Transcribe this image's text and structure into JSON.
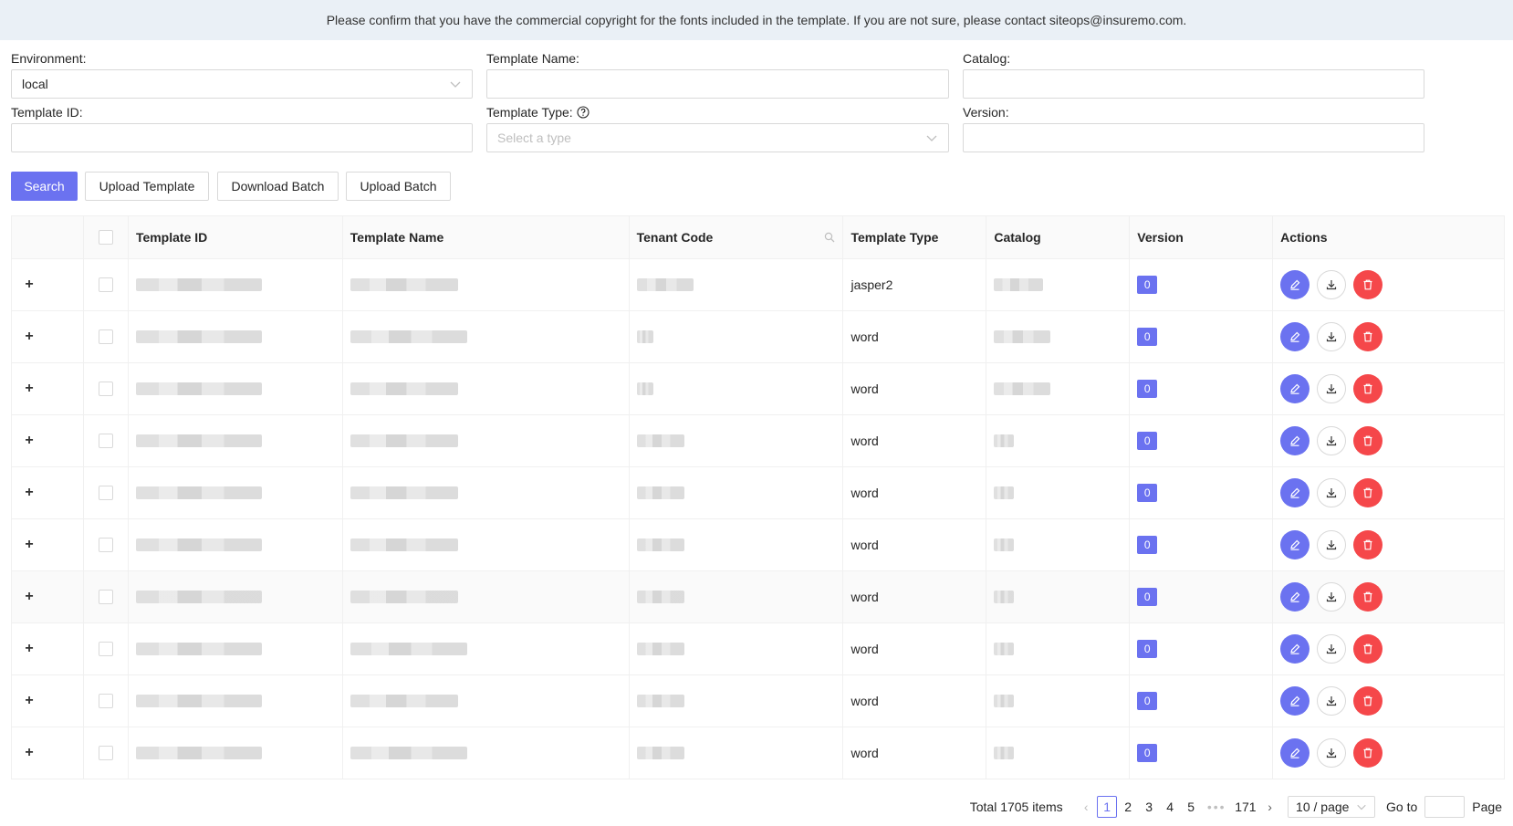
{
  "notice": "Please confirm that you have the commercial copyright for the fonts included in the template. If you are not sure, please contact siteops@insuremo.com.",
  "filters": {
    "environment": {
      "label": "Environment:",
      "value": "local"
    },
    "template_name": {
      "label": "Template Name:",
      "value": ""
    },
    "catalog": {
      "label": "Catalog:",
      "value": ""
    },
    "template_id": {
      "label": "Template ID:",
      "value": ""
    },
    "template_type": {
      "label": "Template Type:",
      "placeholder": "Select a type"
    },
    "version": {
      "label": "Version:",
      "value": ""
    }
  },
  "toolbar": {
    "search": "Search",
    "upload_template": "Upload Template",
    "download_batch": "Download Batch",
    "upload_batch": "Upload Batch"
  },
  "table": {
    "headers": {
      "template_id": "Template ID",
      "template_name": "Template Name",
      "tenant_code": "Tenant Code",
      "template_type": "Template Type",
      "catalog": "Catalog",
      "version": "Version",
      "actions": "Actions"
    },
    "rows": [
      {
        "template_type": "jasper2",
        "version": "0"
      },
      {
        "template_type": "word",
        "version": "0"
      },
      {
        "template_type": "word",
        "version": "0"
      },
      {
        "template_type": "word",
        "version": "0"
      },
      {
        "template_type": "word",
        "version": "0"
      },
      {
        "template_type": "word",
        "version": "0"
      },
      {
        "template_type": "word",
        "version": "0"
      },
      {
        "template_type": "word",
        "version": "0"
      },
      {
        "template_type": "word",
        "version": "0"
      },
      {
        "template_type": "word",
        "version": "0"
      }
    ]
  },
  "pagination": {
    "total": "Total 1705 items",
    "pages": [
      "1",
      "2",
      "3",
      "4",
      "5"
    ],
    "dots": "•••",
    "last": "171",
    "page_size": "10 / page",
    "goto_label": "Go to",
    "page_label": "Page"
  },
  "colors": {
    "primary": "#6b72f0",
    "danger": "#f5474a",
    "notice_bg": "#eaf0f6"
  }
}
